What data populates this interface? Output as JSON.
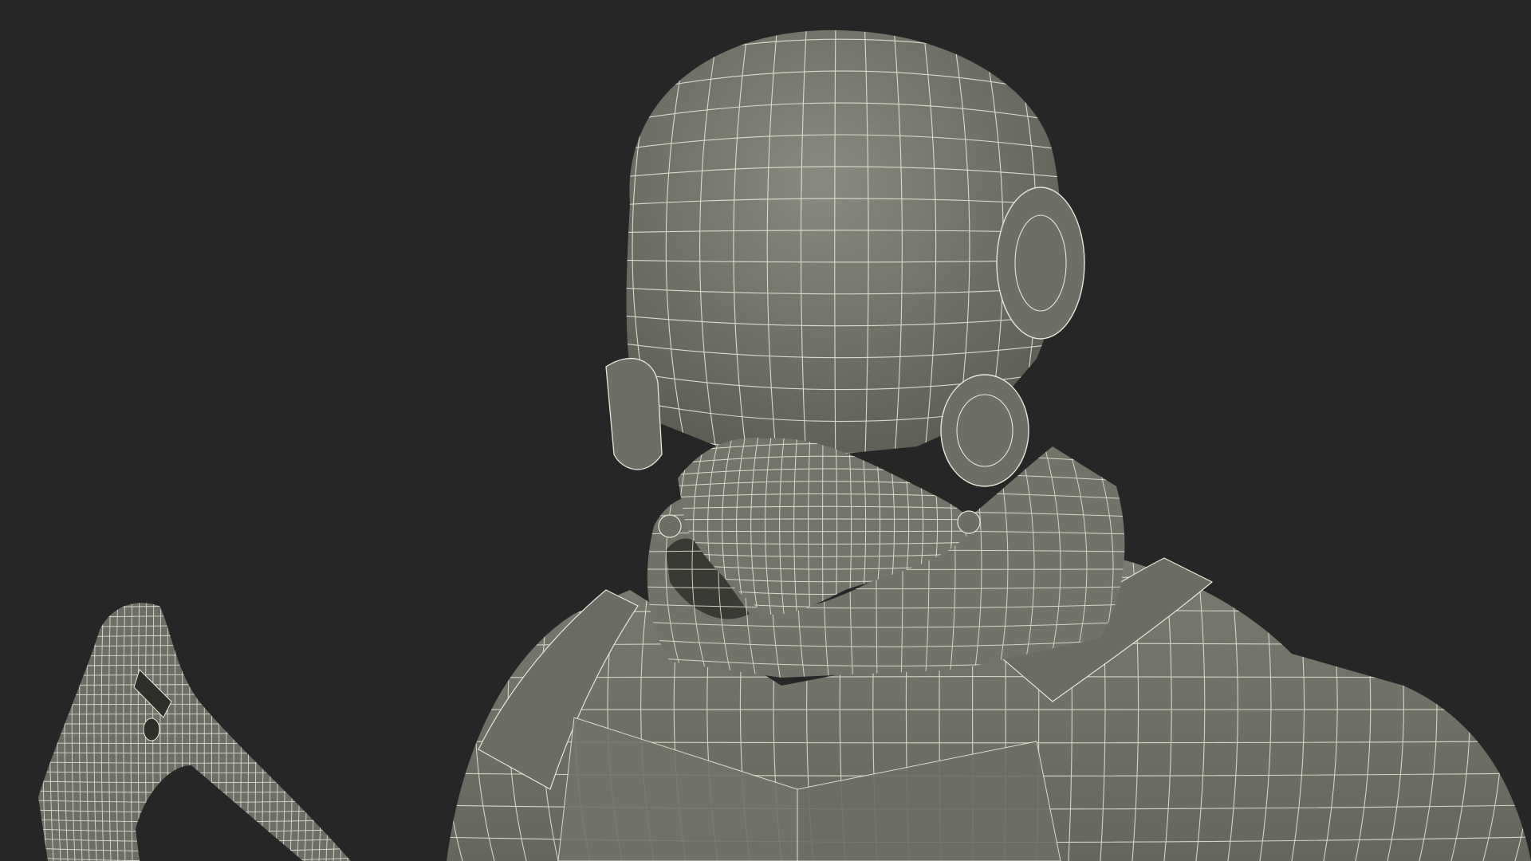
{
  "scene": {
    "background_color": "#262626",
    "surface_color": "#7d7d73",
    "surface_shadow_color": "#5f5f57",
    "surface_dark_color": "#4a4a44",
    "wire_color": "#e6e6d8",
    "subject": "wireframe-armored-soldier-render"
  }
}
